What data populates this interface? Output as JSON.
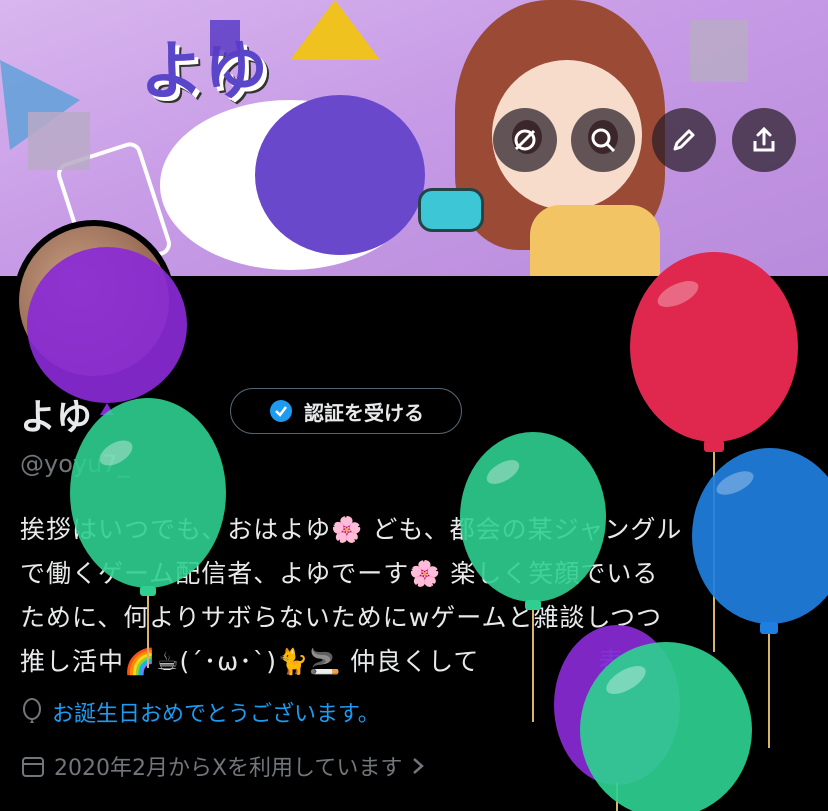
{
  "banner": {
    "logo_text": "よゆ"
  },
  "header_actions": [
    {
      "name": "mute-icon"
    },
    {
      "name": "search-icon"
    },
    {
      "name": "edit-icon"
    },
    {
      "name": "share-icon"
    }
  ],
  "profile": {
    "name": "よゆ",
    "handle": "@yoyu7_",
    "verify_label": "認証を受ける",
    "bio_lines": [
      "挨拶はいつでも、おはよゆ🌸 ども、都会の某ジャングル",
      "で働くゲーム配信者、よゆでーす🌸 楽しく笑顔でいる",
      "ために、何よりサボらないためにwゲームと雑談しつつ",
      "推し活中🌈☕(´･ω･`)🐈🚬 仲良くして"
    ],
    "more_label": "表示",
    "birthday_text": "お誕生日おめでとうございます。",
    "joined_text": "2020年2月からXを利用しています"
  },
  "colors": {
    "link": "#1d9bf0",
    "muted": "#71767b",
    "verified": "#1d9bf0",
    "balloon_purple": "#8a2ad6",
    "balloon_green": "#2ecf8f",
    "balloon_red": "#e0284e",
    "balloon_blue": "#1f7fe0"
  }
}
